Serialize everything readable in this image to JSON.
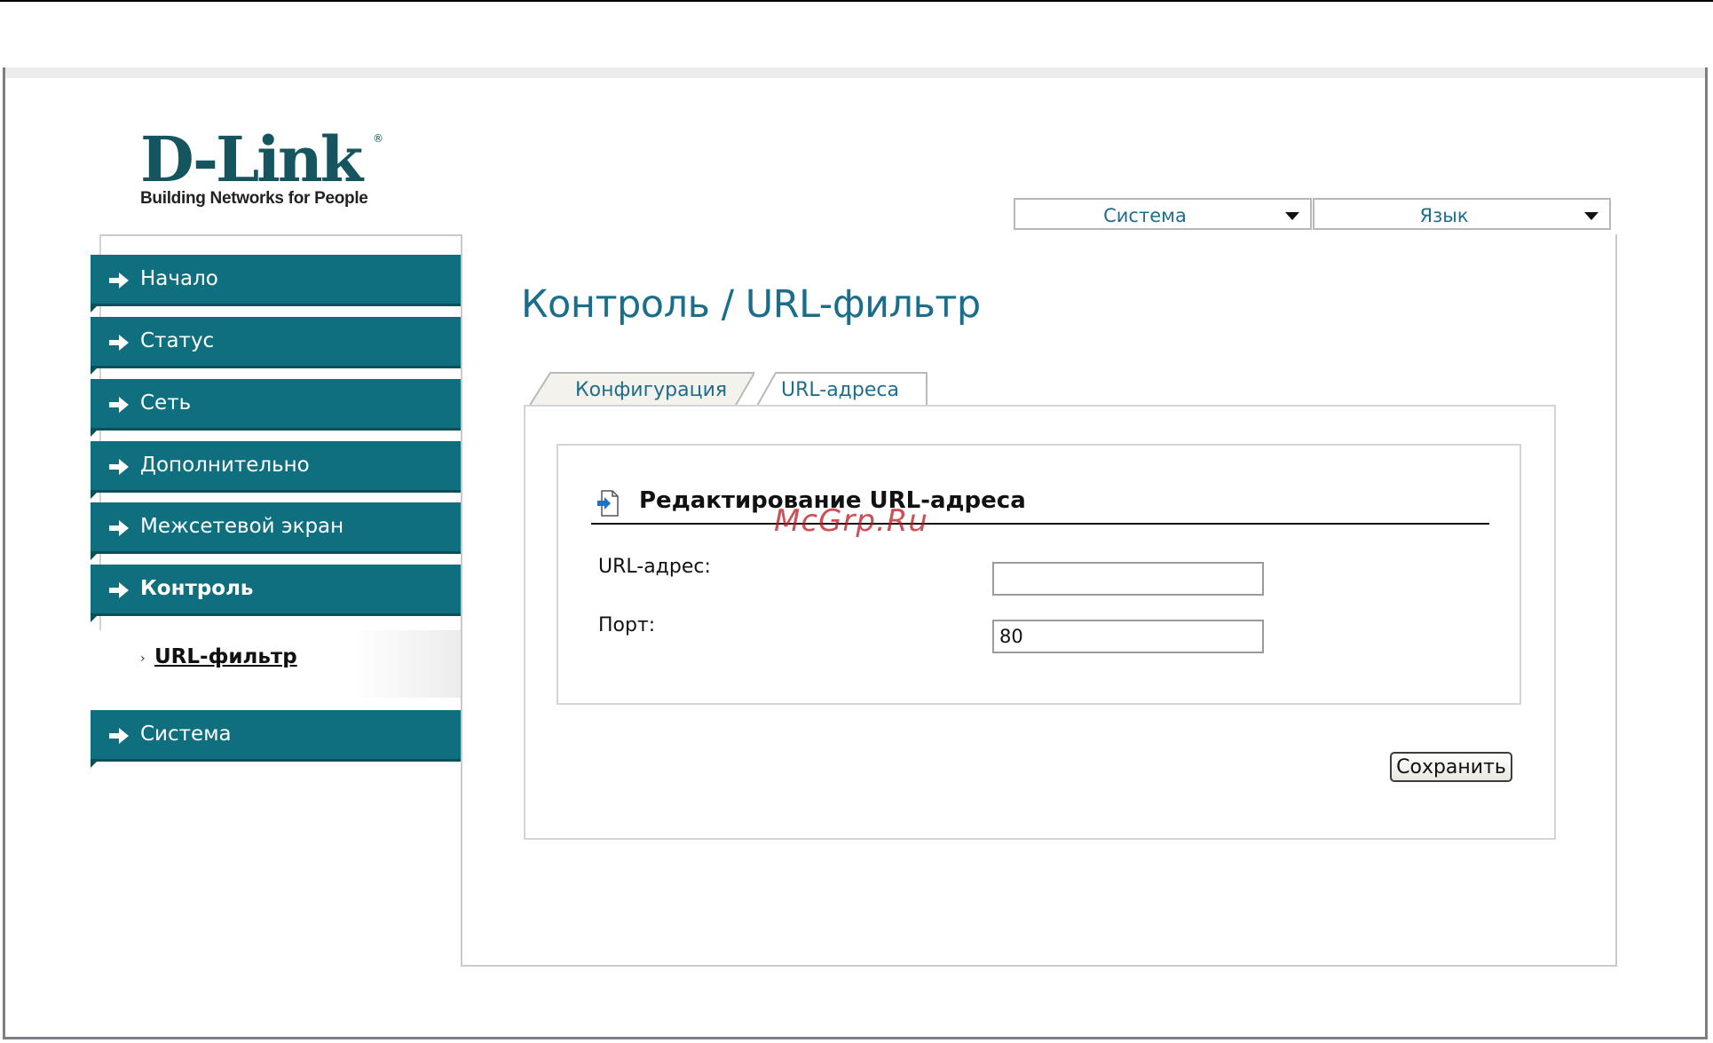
{
  "brand": {
    "logo_text": "D-Link",
    "logo_reg": "®",
    "tagline": "Building Networks for People"
  },
  "top_menus": [
    {
      "label": "Система"
    },
    {
      "label": "Язык"
    }
  ],
  "sidebar": {
    "items": [
      {
        "label": "Начало"
      },
      {
        "label": "Статус"
      },
      {
        "label": "Сеть"
      },
      {
        "label": "Дополнительно"
      },
      {
        "label": "Межсетевой экран"
      },
      {
        "label": "Контроль",
        "expanded": true
      },
      {
        "label": "Система"
      }
    ],
    "sub_items": [
      {
        "label": "URL-фильтр",
        "active": true
      }
    ]
  },
  "page": {
    "title": "Контроль /  URL-фильтр"
  },
  "tabs": [
    {
      "label": "Конфигурация",
      "active": false
    },
    {
      "label": "URL-адреса",
      "active": true
    }
  ],
  "section": {
    "title": "Редактирование URL-адреса",
    "fields": [
      {
        "label": "URL-адрес:",
        "value": "",
        "placeholder": ""
      },
      {
        "label": "Порт:",
        "value": "80",
        "placeholder": ""
      }
    ]
  },
  "actions": {
    "save_label": "Сохранить"
  },
  "watermark": "McGrp.Ru",
  "colors": {
    "nav_bg": "#0f6f7e",
    "accent_text": "#1f6d8c",
    "title": "#1a6e8a",
    "watermark": "#be141e"
  }
}
